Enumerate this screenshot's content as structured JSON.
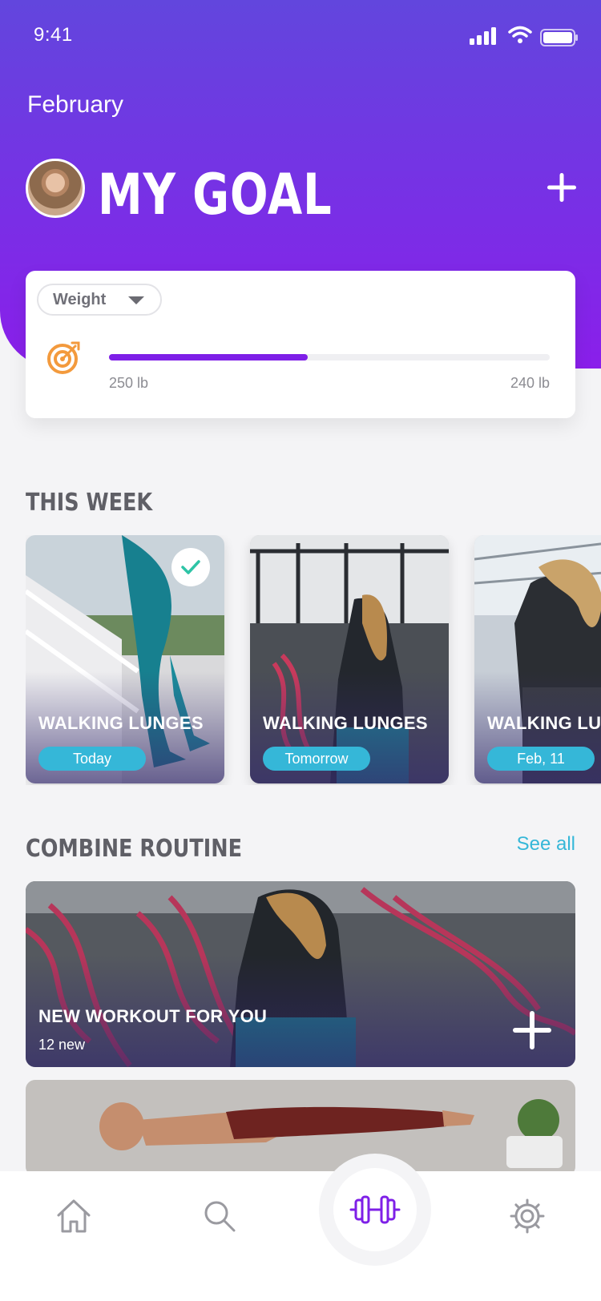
{
  "status_bar": {
    "time": "9:41"
  },
  "header": {
    "month": "February",
    "title": "MY GOAL"
  },
  "goal": {
    "metric": "Weight",
    "start_label": "250 lb",
    "end_label": "240 lb",
    "progress": 0.45
  },
  "this_week": {
    "title": "THIS WEEK",
    "cards": [
      {
        "title": "WALKING LUNGES",
        "date": "Today",
        "completed": true
      },
      {
        "title": "WALKING LUNGES",
        "date": "Tomorrow",
        "completed": false
      },
      {
        "title": "WALKING LUNGES",
        "date": "Feb, 11",
        "completed": false
      }
    ]
  },
  "combine_routine": {
    "title": "COMBINE ROUTINE",
    "see_all": "See all",
    "card": {
      "title": "NEW WORKOUT FOR YOU",
      "subtitle": "12 new"
    }
  },
  "nav": {
    "items": [
      "home-icon",
      "search-icon",
      "dumbbell-icon",
      "gear-icon"
    ],
    "active": "dumbbell-icon"
  },
  "colors": {
    "accent": "#7E1FE7",
    "header_top": "#6246DD",
    "pill": "#35B7D8",
    "link": "#35B7D8",
    "target": "#F39A3D"
  }
}
